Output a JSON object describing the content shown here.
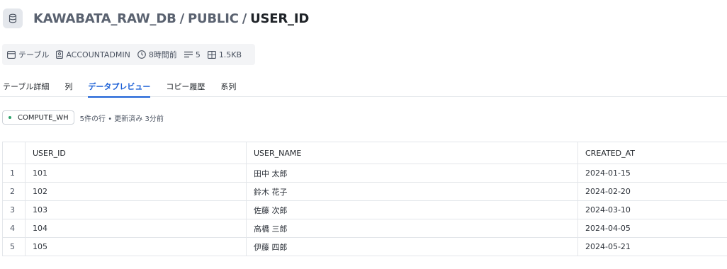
{
  "header": {
    "icon": "database-icon",
    "breadcrumb": [
      "KAWABATA_RAW_DB",
      "PUBLIC"
    ],
    "separator": "/",
    "current": "USER_ID"
  },
  "meta": {
    "type": "テーブル",
    "owner": "ACCOUNTADMIN",
    "updated": "8時間前",
    "columns": "5",
    "size": "1.5KB"
  },
  "tabs": [
    {
      "label": "テーブル詳細",
      "active": false
    },
    {
      "label": "列",
      "active": false
    },
    {
      "label": "データプレビュー",
      "active": true
    },
    {
      "label": "コピー履歴",
      "active": false
    },
    {
      "label": "系列",
      "active": false
    }
  ],
  "warehouse": {
    "name": "COMPUTE_WH",
    "status_color": "#2ea36b",
    "info": "5件の行 • 更新済み 3分前"
  },
  "table": {
    "columns": [
      "USER_ID",
      "USER_NAME",
      "CREATED_AT"
    ],
    "rows": [
      {
        "num": "1",
        "cells": [
          "101",
          "田中 太郎",
          "2024-01-15"
        ]
      },
      {
        "num": "2",
        "cells": [
          "102",
          "鈴木 花子",
          "2024-02-20"
        ]
      },
      {
        "num": "3",
        "cells": [
          "103",
          "佐藤 次郎",
          "2024-03-10"
        ]
      },
      {
        "num": "4",
        "cells": [
          "104",
          "高橋 三郎",
          "2024-04-05"
        ]
      },
      {
        "num": "5",
        "cells": [
          "105",
          "伊藤 四郎",
          "2024-05-21"
        ]
      }
    ]
  },
  "colors": {
    "accent": "#1a5fd6",
    "title_muted": "#5a6270"
  }
}
